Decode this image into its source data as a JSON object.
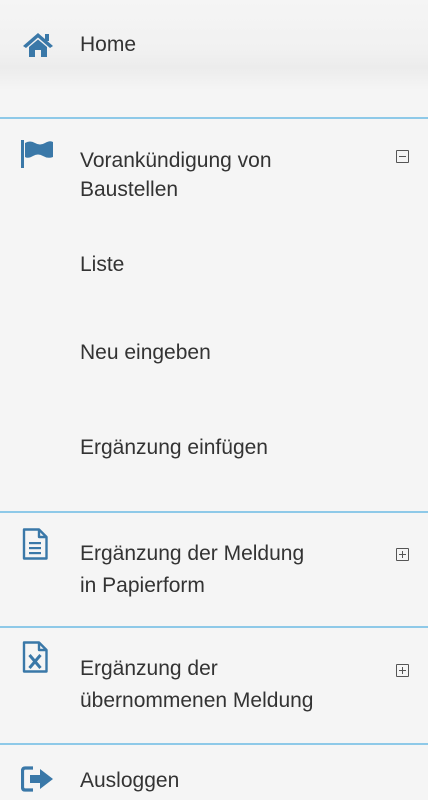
{
  "menu": {
    "home": {
      "label": "Home",
      "icon": "home-icon"
    },
    "baustellen": {
      "label_line1": "Vorankündigung von",
      "label_line2": "Baustellen",
      "icon": "flag-icon",
      "toggle": "collapse",
      "subitems": [
        {
          "label": "Liste"
        },
        {
          "label": "Neu eingeben"
        },
        {
          "label": "Ergänzung einfügen"
        }
      ]
    },
    "papierform": {
      "label_line1": "Ergänzung der Meldung",
      "label_line2": "in Papierform",
      "icon": "document-icon",
      "toggle": "expand"
    },
    "uebernommen": {
      "label_line1": "Ergänzung der",
      "label_line2": "übernommenen Meldung",
      "icon": "excel-file-icon",
      "toggle": "expand"
    },
    "logout": {
      "label": "Ausloggen",
      "icon": "sign-out-icon"
    }
  },
  "colors": {
    "background": "#f5f5f5",
    "divider": "#8ec9e8",
    "icon": "#3a78a8",
    "text": "#333333"
  }
}
